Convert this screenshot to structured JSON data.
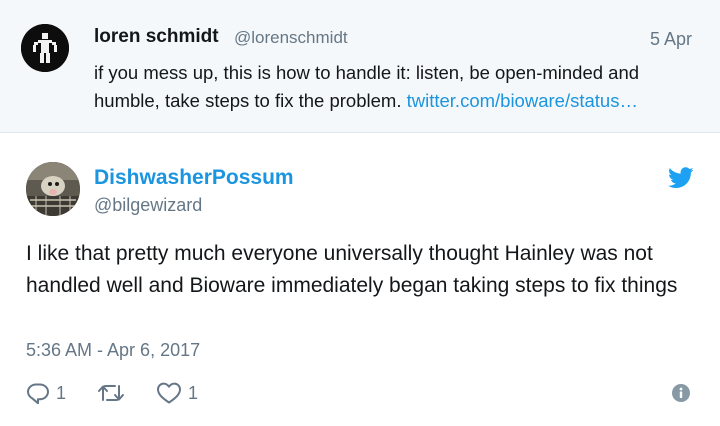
{
  "parent_tweet": {
    "avatar_icon": "stick-figure-avatar-icon",
    "name": "loren schmidt",
    "handle": "@lorenschmidt",
    "date": "5 Apr",
    "text": "if you mess up, this is how to handle it: listen, be open-minded and humble, take steps to fix the problem. ",
    "link": "twitter.com/bioware/status…"
  },
  "tweet": {
    "author_name": "DishwasherPossum",
    "author_handle": "@bilgewizard",
    "brand_icon": "twitter-bird-icon",
    "text": "I like that pretty much everyone universally thought Hainley was not handled well and Bioware immediately began taking steps to fix things",
    "timestamp": "5:36 AM - Apr 6, 2017",
    "actions": {
      "reply_count": "1",
      "like_count": "1"
    }
  },
  "colors": {
    "link": "#1b95e0",
    "muted": "#657786",
    "text": "#14171a",
    "parent_bg": "#f5f8fa"
  }
}
